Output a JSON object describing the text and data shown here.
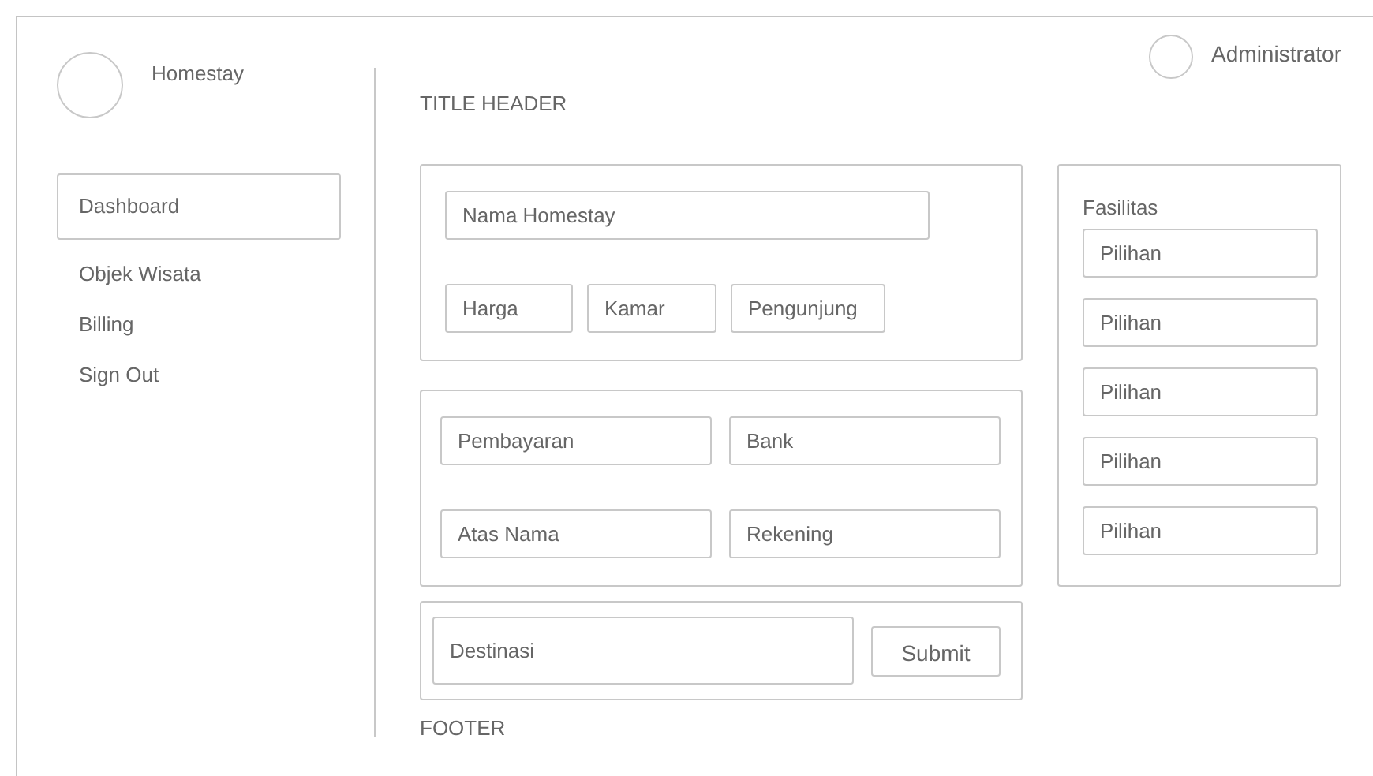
{
  "brand": {
    "name": "Homestay"
  },
  "user": {
    "name": "Administrator"
  },
  "sidebar": {
    "items": [
      {
        "label": "Dashboard",
        "selected": true
      },
      {
        "label": "Objek Wisata",
        "selected": false
      },
      {
        "label": "Billing",
        "selected": false
      },
      {
        "label": "Sign Out",
        "selected": false
      }
    ]
  },
  "title": "TITLE HEADER",
  "details": {
    "name_field": {
      "placeholder": "Nama Homestay"
    },
    "fields": [
      {
        "placeholder": "Harga"
      },
      {
        "placeholder": "Kamar"
      },
      {
        "placeholder": "Pengunjung"
      }
    ]
  },
  "payment": {
    "fields": [
      {
        "placeholder": "Pembayaran"
      },
      {
        "placeholder": "Bank"
      },
      {
        "placeholder": "Atas Nama"
      },
      {
        "placeholder": "Rekening"
      }
    ]
  },
  "destination": {
    "field": {
      "placeholder": "Destinasi"
    },
    "submit": "Submit"
  },
  "footer": "FOOTER",
  "facilities": {
    "title": "Fasilitas",
    "options": [
      {
        "placeholder": "Pilihan"
      },
      {
        "placeholder": "Pilihan"
      },
      {
        "placeholder": "Pilihan"
      },
      {
        "placeholder": "Pilihan"
      },
      {
        "placeholder": "Pilihan"
      }
    ]
  }
}
